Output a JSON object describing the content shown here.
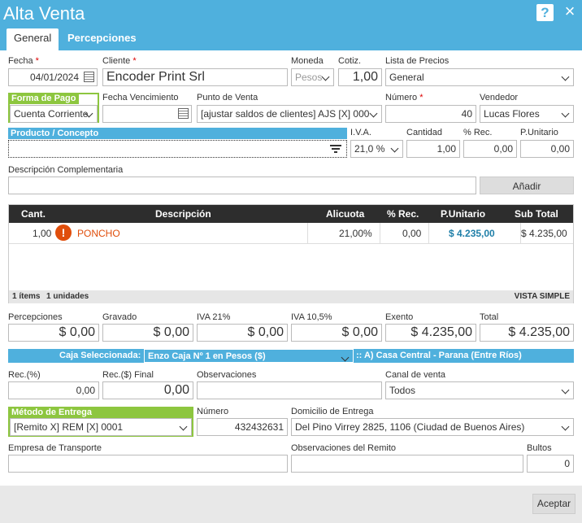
{
  "window": {
    "title": "Alta Venta"
  },
  "tabs": {
    "general": "General",
    "percepciones": "Percepciones"
  },
  "labels": {
    "fecha": "Fecha",
    "cliente": "Cliente",
    "moneda": "Moneda",
    "cotiz": "Cotiz.",
    "lista_precios": "Lista de Precios",
    "forma_pago": "Forma de Pago",
    "fecha_venc": "Fecha Vencimiento",
    "punto_venta": "Punto de Venta",
    "numero": "Número",
    "vendedor": "Vendedor",
    "producto": "Producto / Concepto",
    "iva": "I.V.A.",
    "cantidad": "Cantidad",
    "pct_rec": "% Rec.",
    "punitario": "P.Unitario",
    "desc_comp": "Descripción Complementaria",
    "percepciones": "Percepciones",
    "gravado": "Gravado",
    "iva21": "IVA 21%",
    "iva105": "IVA 10,5%",
    "exento": "Exento",
    "total": "Total",
    "rec_pct": "Rec.(%)",
    "rec_final": "Rec.($) Final",
    "observaciones": "Observaciones",
    "canal": "Canal de venta",
    "metodo_entrega": "Método de Entrega",
    "numero2": "Número",
    "domicilio": "Domicilio de Entrega",
    "empresa_transporte": "Empresa de Transporte",
    "obs_remito": "Observaciones del Remito",
    "bultos": "Bultos",
    "required_mark": "*"
  },
  "values": {
    "fecha": "04/01/2024",
    "cliente": "Encoder Print Srl",
    "moneda": "Pesos",
    "cotiz": "1,00",
    "lista_precios": "General",
    "forma_pago": "Cuenta Corriente",
    "fecha_venc": "",
    "punto_venta": "[ajustar saldos de clientes] AJS [X] 000",
    "numero": "40",
    "vendedor": "Lucas Flores",
    "producto": "",
    "iva": "21,0 %",
    "cantidad": "1,00",
    "pct_rec": "0,00",
    "punitario": "0,00",
    "desc_comp": "",
    "percepciones": "$ 0,00",
    "gravado": "$ 0,00",
    "iva21": "$ 0,00",
    "iva105": "$ 0,00",
    "exento": "$ 4.235,00",
    "total": "$ 4.235,00",
    "rec_pct": "0,00",
    "rec_final": "0,00",
    "observaciones": "",
    "canal": "Todos",
    "metodo_entrega": "[Remito X] REM [X] 0001",
    "numero2": "432432631",
    "domicilio": "Del Pino Virrey 2825, 1106 (Ciudad de Buenos Aires)",
    "empresa_transporte": "",
    "obs_remito": "",
    "bultos": "0"
  },
  "buttons": {
    "anadir": "Añadir",
    "aceptar": "Aceptar"
  },
  "grid": {
    "headers": [
      "Cant.",
      "Descripción",
      "Alicuota",
      "% Rec.",
      "P.Unitario",
      "Sub Total"
    ],
    "rows": [
      {
        "cant": "1,00",
        "desc": "PONCHO",
        "alicuota": "21,00%",
        "rec": "0,00",
        "punitario": "$ 4.235,00",
        "subtotal": "$ 4.235,00"
      }
    ],
    "footer_items": "1 ítems",
    "footer_units": "1 unidades",
    "vista": "VISTA SIMPLE"
  },
  "caja": {
    "label": "Caja Seleccionada:",
    "value": "Enzo Caja Nº 1 en Pesos ($)",
    "sucursal": ":: A) Casa Central - Parana (Entre Ríos)"
  },
  "colors": {
    "accent": "#4fb0dd",
    "green": "#8dc63f",
    "warning": "#e04e0b",
    "price": "#1f7fa8"
  },
  "icons": {
    "help": "?",
    "close": "×",
    "warning": "!"
  }
}
